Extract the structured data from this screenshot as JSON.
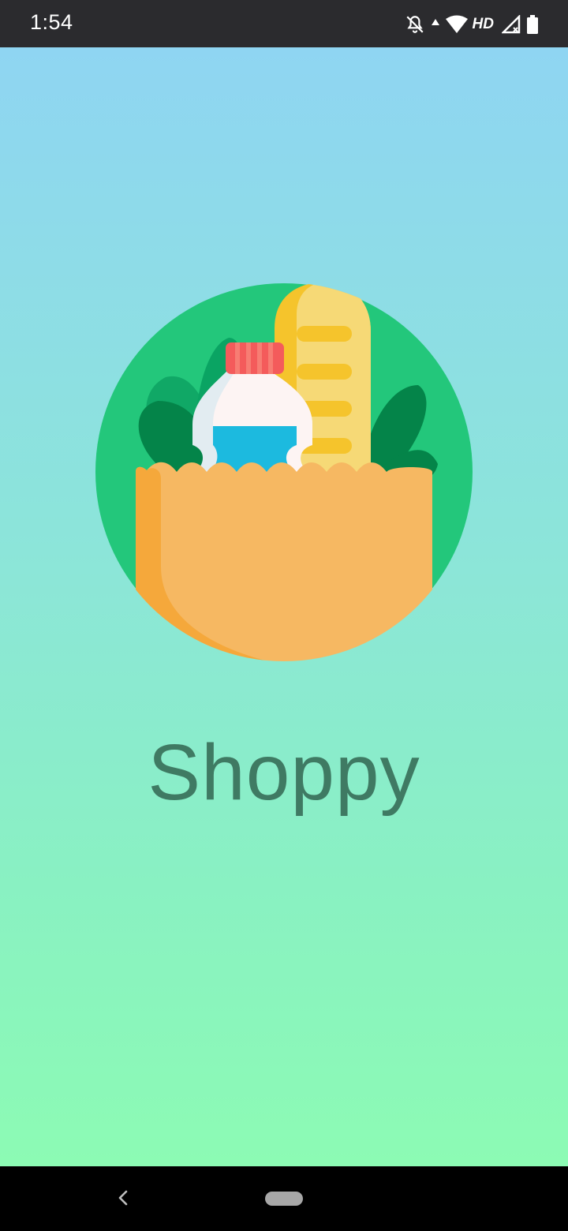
{
  "status_bar": {
    "time": "1:54",
    "network_label": "HD",
    "icons": [
      "notifications-off-icon",
      "data-up-icon",
      "wifi-icon",
      "signal-icon",
      "battery-icon"
    ]
  },
  "splash": {
    "app_name": "Shoppy",
    "logo_icon": "grocery-bag-icon",
    "colors": {
      "gradient_top": "#8fd5f2",
      "gradient_bottom": "#8cfbb4",
      "circle": "#23c77b",
      "text": "#3f7a63"
    }
  },
  "nav_bar": {
    "back_icon": "back-chevron-icon",
    "home_icon": "home-pill-icon"
  }
}
